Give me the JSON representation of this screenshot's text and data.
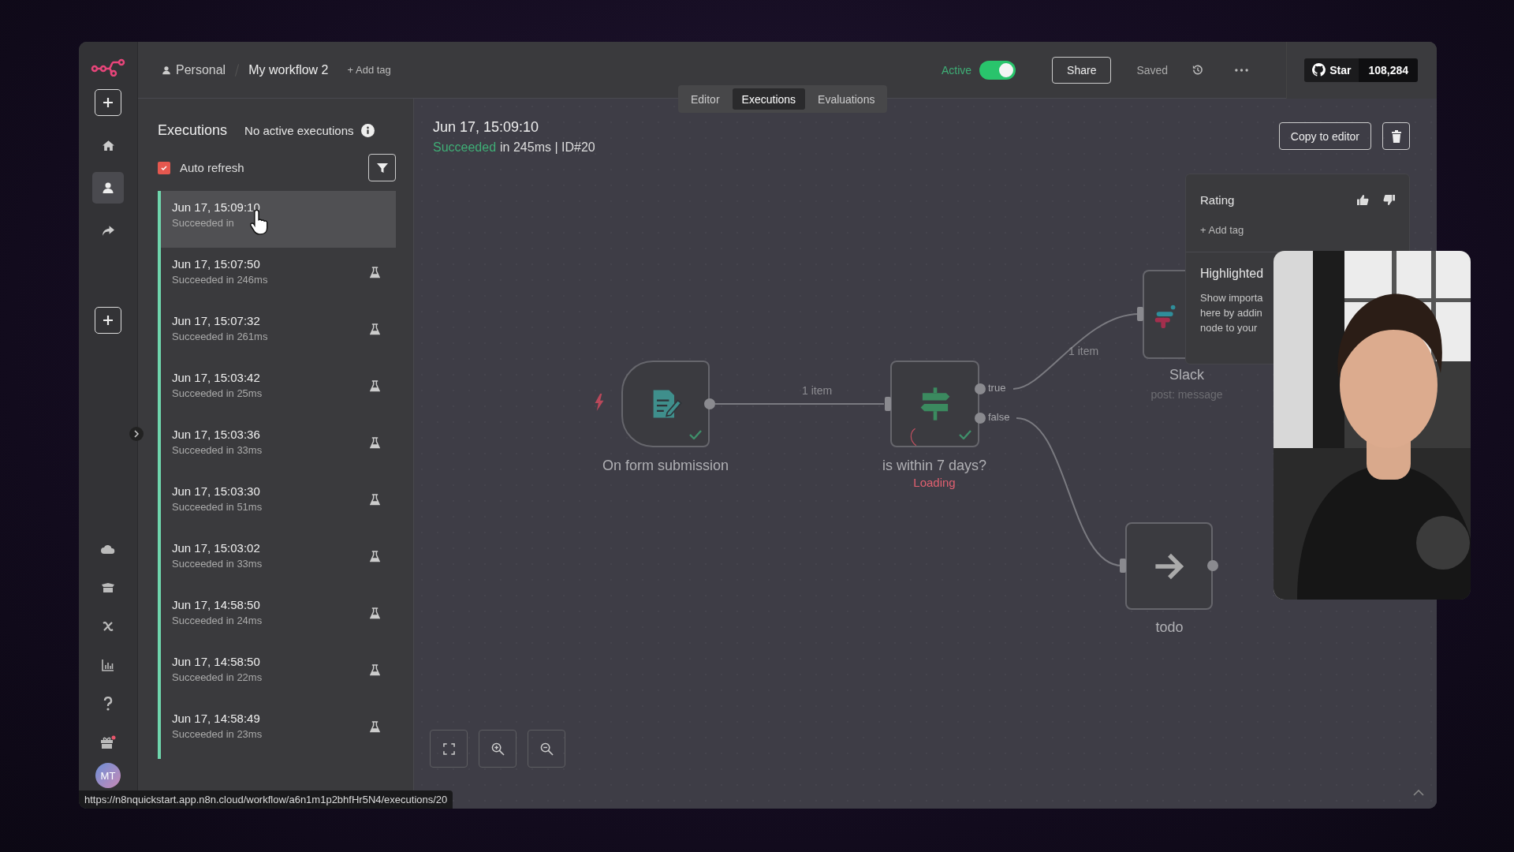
{
  "sidebar": {
    "nav": [
      {
        "kind": "home",
        "selected": false
      },
      {
        "kind": "person",
        "selected": true
      },
      {
        "kind": "share",
        "selected": false
      }
    ],
    "tools": [
      {
        "kind": "cloud"
      },
      {
        "kind": "box"
      },
      {
        "kind": "variable"
      },
      {
        "kind": "chart"
      },
      {
        "kind": "help"
      },
      {
        "kind": "gift"
      }
    ],
    "avatar": "MT"
  },
  "header": {
    "project": "Personal",
    "workflow": "My workflow 2",
    "add_tag": "+ Add tag",
    "active": {
      "label": "Active",
      "on": true
    },
    "share": "Share",
    "saved": "Saved",
    "github": {
      "label": "Star",
      "count": "108,284"
    }
  },
  "tabs": [
    {
      "label": "Editor",
      "selected": false
    },
    {
      "label": "Executions",
      "selected": true
    },
    {
      "label": "Evaluations",
      "selected": false
    }
  ],
  "executions": {
    "title": "Executions",
    "status": "No active executions",
    "auto_refresh": {
      "label": "Auto refresh",
      "checked": true
    },
    "items": [
      {
        "time": "Jun 17, 15:09:10",
        "status": "Succeeded in",
        "selected": true
      },
      {
        "time": "Jun 17, 15:07:50",
        "status": "Succeeded in 246ms",
        "selected": false
      },
      {
        "time": "Jun 17, 15:07:32",
        "status": "Succeeded in 261ms",
        "selected": false
      },
      {
        "time": "Jun 17, 15:03:42",
        "status": "Succeeded in 25ms",
        "selected": false
      },
      {
        "time": "Jun 17, 15:03:36",
        "status": "Succeeded in 33ms",
        "selected": false
      },
      {
        "time": "Jun 17, 15:03:30",
        "status": "Succeeded in 51ms",
        "selected": false
      },
      {
        "time": "Jun 17, 15:03:02",
        "status": "Succeeded in 33ms",
        "selected": false
      },
      {
        "time": "Jun 17, 14:58:50",
        "status": "Succeeded in 24ms",
        "selected": false
      },
      {
        "time": "Jun 17, 14:58:50",
        "status": "Succeeded in 22ms",
        "selected": false
      },
      {
        "time": "Jun 17, 14:58:49",
        "status": "Succeeded in 23ms",
        "selected": false
      }
    ]
  },
  "detail": {
    "time": "Jun 17, 15:09:10",
    "status": "Succeeded",
    "summary": "in 245ms | ID#20",
    "copy": "Copy to editor"
  },
  "annotations": {
    "rating": "Rating",
    "add_tag": "+ Add tag",
    "highlighted": "Highlighted",
    "lines": [
      "Show importa",
      "here by addin",
      "node to your"
    ]
  },
  "canvas": {
    "nodes": [
      {
        "kind": "form",
        "name": "On form submission",
        "succeeded": true
      },
      {
        "kind": "if",
        "name": "is within 7 days?",
        "status": "Loading",
        "succeeded": true,
        "outputs": [
          "true",
          "false"
        ]
      },
      {
        "kind": "slack",
        "name": "Slack",
        "subtitle": "post: message",
        "succeeded": false
      },
      {
        "kind": "noop",
        "name": "todo",
        "succeeded": false
      }
    ],
    "edges": [
      {
        "kind": "labeled",
        "label": "1 item"
      },
      {
        "kind": "labeled",
        "label": "1 item"
      },
      {
        "kind": "plain"
      }
    ]
  },
  "status_url": "https://n8nquickstart.app.n8n.cloud/workflow/a6n1m1p2bhfHr5N4/executions/20"
}
